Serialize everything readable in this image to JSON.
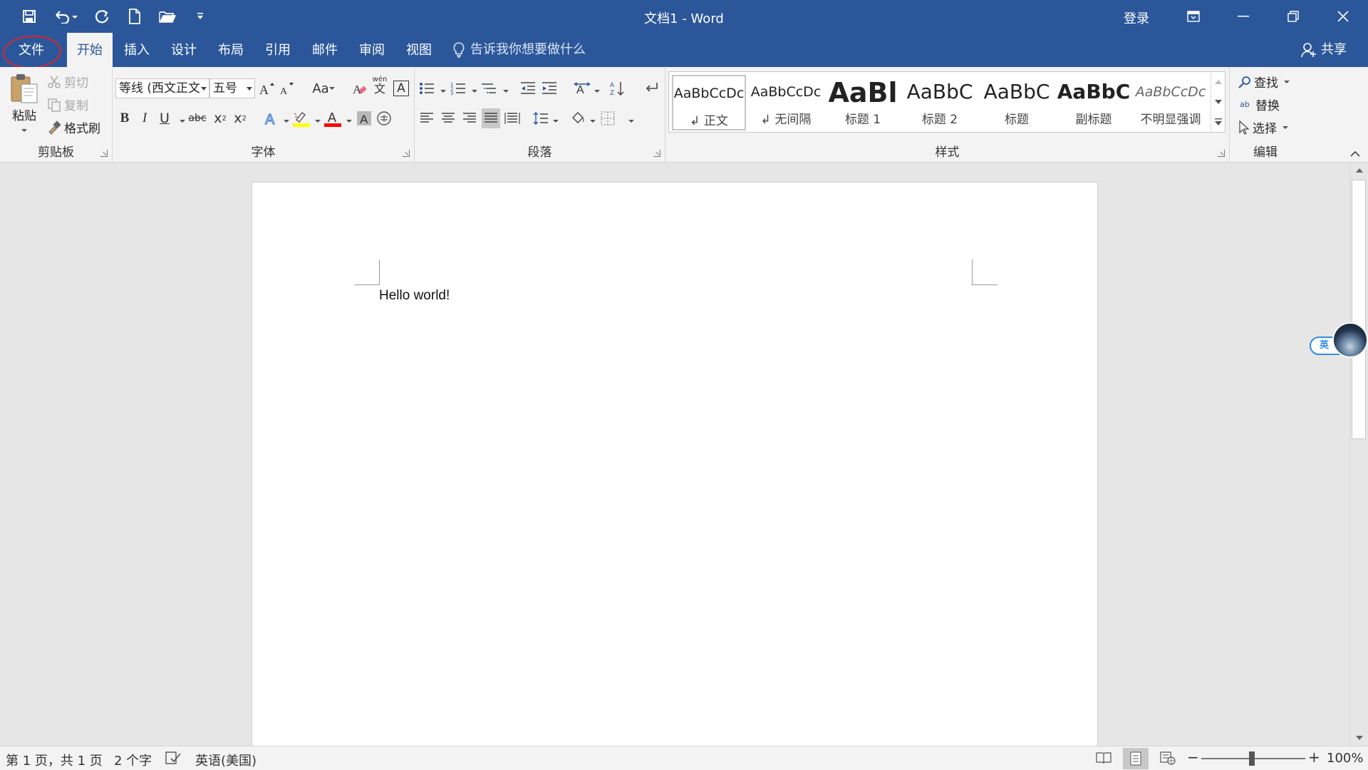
{
  "window": {
    "title": "文档1  -  Word",
    "login": "登录"
  },
  "tabs": {
    "file": "文件",
    "home": "开始",
    "insert": "插入",
    "design": "设计",
    "layout": "布局",
    "references": "引用",
    "mailings": "邮件",
    "review": "审阅",
    "view": "视图",
    "tell_me": "告诉我你想要做什么",
    "share": "共享"
  },
  "clipboard": {
    "paste": "粘贴",
    "cut": "剪切",
    "copy": "复制",
    "format_painter": "格式刷",
    "label": "剪贴板"
  },
  "font": {
    "name": "等线 (西文正文",
    "size": "五号",
    "change_case": "Aa",
    "phonetic": "wén",
    "phonetic_char": "文",
    "border_char": "A",
    "bold": "B",
    "italic": "I",
    "underline": "U",
    "strike": "abc",
    "sub": "x",
    "sub_small": "2",
    "sup": "x",
    "sup_small": "2",
    "label": "字体"
  },
  "paragraph": {
    "label": "段落"
  },
  "styles": {
    "label": "样式",
    "items": [
      {
        "preview": "AaBbCcDc",
        "name": "↲ 正文"
      },
      {
        "preview": "AaBbCcDc",
        "name": "↲ 无间隔"
      },
      {
        "preview": "AaBl",
        "name": "标题 1"
      },
      {
        "preview": "AaBbC",
        "name": "标题 2"
      },
      {
        "preview": "AaBbC",
        "name": "标题"
      },
      {
        "preview": "AaBbC",
        "name": "副标题"
      },
      {
        "preview": "AaBbCcDc",
        "name": "不明显强调"
      }
    ]
  },
  "editing": {
    "find": "查找",
    "replace": "替换",
    "select": "选择",
    "label": "编辑",
    "replace_icon_text": "ab"
  },
  "document": {
    "text": "Hello world!"
  },
  "ime": {
    "label": "英"
  },
  "status": {
    "page": "第 1 页，共 1 页",
    "words": "2 个字",
    "language": "英语(美国)",
    "zoom": "100%",
    "zoom_minus": "−",
    "zoom_plus": "+"
  }
}
